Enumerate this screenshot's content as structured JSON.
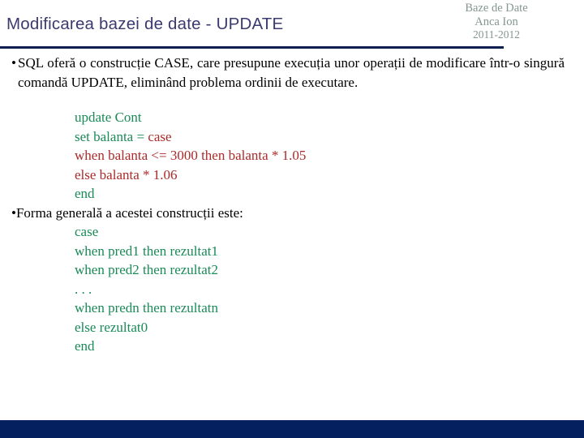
{
  "slide": {
    "title": "Modificarea bazei de date - UPDATE",
    "header_meta": {
      "course": "Baze de Date",
      "author": "Anca Ion",
      "year": "2011-2012"
    },
    "colors": {
      "title": "#3a3a6e",
      "header_meta": "#83978f",
      "rule": "#0b1f4e",
      "footer": "#04205e",
      "code_green": "#1a8a57",
      "code_red": "#ab2a2a",
      "body_text": "#000000"
    },
    "bullets": {
      "first": {
        "marker": "•",
        "text": "SQL oferă o construcție  CASE, care presupune execuția unor operații de modificare  într-o  singură  comandă  UPDATE,  eliminând  problema ordinii de executare."
      },
      "second": {
        "marker": "•",
        "text": "Forma generală a acestei construcții este:"
      }
    },
    "code_example": {
      "lines": [
        {
          "segments": [
            {
              "text": "update Cont",
              "color": "green"
            }
          ]
        },
        {
          "segments": [
            {
              "text": "set balanta = ",
              "color": "green"
            },
            {
              "text": "case",
              "color": "red"
            }
          ]
        },
        {
          "segments": [
            {
              "text": "when balanta <= 3000 then balanta * 1.05",
              "color": "red"
            }
          ]
        },
        {
          "segments": [
            {
              "text": "else balanta * 1.06",
              "color": "red"
            }
          ]
        },
        {
          "segments": [
            {
              "text": "end",
              "color": "green"
            }
          ]
        }
      ]
    },
    "code_syntax": {
      "lines": [
        {
          "segments": [
            {
              "text": "case",
              "color": "green"
            }
          ]
        },
        {
          "segments": [
            {
              "text": "when pred1 then rezultat1",
              "color": "green"
            }
          ]
        },
        {
          "segments": [
            {
              "text": "when pred2 then rezultat2",
              "color": "green"
            }
          ]
        },
        {
          "segments": [
            {
              "text": ". . .",
              "color": "green"
            }
          ]
        },
        {
          "segments": [
            {
              "text": "when predn then rezultatn",
              "color": "green"
            }
          ]
        },
        {
          "segments": [
            {
              "text": "else rezultat0",
              "color": "green"
            }
          ]
        },
        {
          "segments": [
            {
              "text": "end",
              "color": "green"
            }
          ]
        }
      ]
    }
  }
}
